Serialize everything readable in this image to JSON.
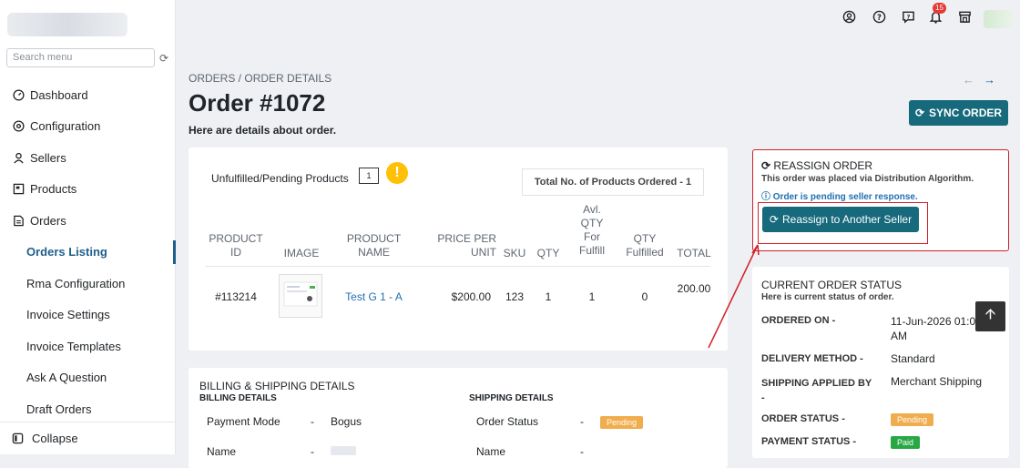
{
  "sidebar": {
    "search_placeholder": "Search menu",
    "items": [
      {
        "label": "Dashboard"
      },
      {
        "label": "Configuration"
      },
      {
        "label": "Sellers"
      },
      {
        "label": "Products"
      },
      {
        "label": "Orders"
      }
    ],
    "subitems": [
      {
        "label": "Orders Listing"
      },
      {
        "label": "Rma Configuration"
      },
      {
        "label": "Invoice Settings"
      },
      {
        "label": "Invoice Templates"
      },
      {
        "label": "Ask A Question"
      },
      {
        "label": "Draft Orders"
      }
    ],
    "collapse_label": "Collapse"
  },
  "topbar": {
    "notification_count": "15"
  },
  "page": {
    "breadcrumb_root": "ORDERS",
    "breadcrumb_sep": " / ",
    "breadcrumb_current": "ORDER DETAILS",
    "title": "Order #1072",
    "subtitle": "Here are details about order.",
    "sync_label": "SYNC ORDER"
  },
  "products_card": {
    "heading": "Unfulfilled/Pending Products",
    "count": "1",
    "total_label": "Total No. of Products Ordered - ",
    "total_value": "1",
    "columns": [
      "PRODUCT ID",
      "IMAGE",
      "PRODUCT NAME",
      "PRICE PER UNIT",
      "SKU",
      "QTY",
      "Avl. QTY For Fulfill",
      "QTY Fulfilled",
      "TOTAL"
    ],
    "rows": [
      {
        "id": "#113214",
        "name": "Test G 1 - A",
        "price": "$200.00",
        "sku": "123",
        "qty": "1",
        "avl": "1",
        "fulfilled": "0",
        "total": "200.00"
      }
    ]
  },
  "billing": {
    "heading": "BILLING & SHIPPING DETAILS",
    "billing_title": "BILLING DETAILS",
    "shipping_title": "SHIPPING DETAILS",
    "payment_mode_label": "Payment Mode",
    "payment_mode_value": "Bogus",
    "order_status_label": "Order Status",
    "order_status_value": "Pending",
    "name_label": "Name",
    "dash": "-"
  },
  "reassign": {
    "heading": "REASSIGN ORDER",
    "note": "This order was placed via Distribution Algorithm.",
    "info": "Order is pending seller response.",
    "button_label": "Reassign to Another Seller"
  },
  "status": {
    "heading": "CURRENT ORDER STATUS",
    "subheading": "Here is current status of order.",
    "ordered_on_label": "ORDERED ON -",
    "ordered_on_value": "11-Jun-2026 01:00 AM",
    "delivery_label": "DELIVERY METHOD -",
    "delivery_value": "Standard",
    "shipping_label": "SHIPPING APPLIED BY -",
    "shipping_value": "Merchant Shipping",
    "order_status_label": "ORDER STATUS -",
    "order_status_value": "Pending",
    "payment_status_label": "PAYMENT STATUS -",
    "payment_status_value": "Paid"
  },
  "colors": {
    "accent": "#17697c",
    "pending": "#f0ad4e",
    "paid": "#28a745",
    "highlight": "#d4202a",
    "link": "#1f6fb0"
  }
}
